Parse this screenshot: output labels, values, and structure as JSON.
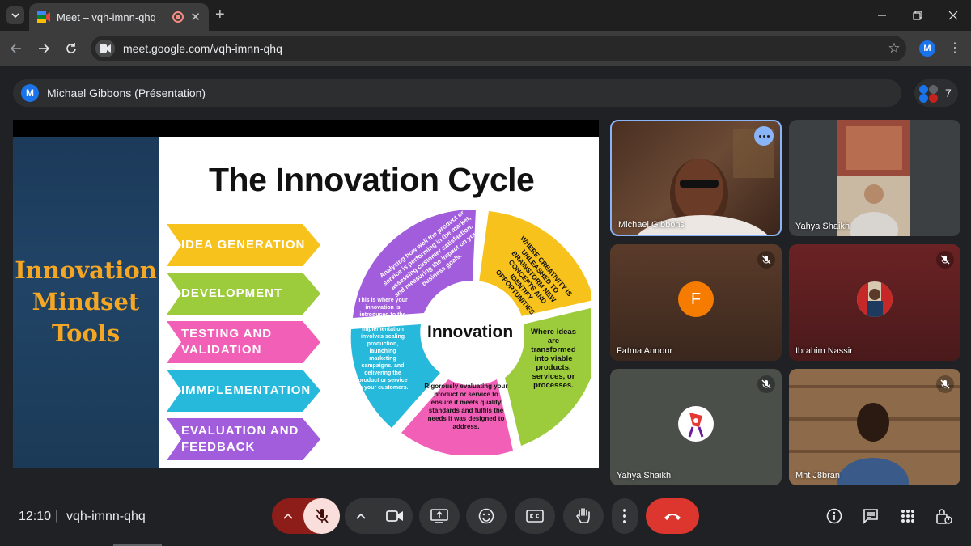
{
  "browser": {
    "tab_title": "Meet – vqh-imnn-qhq",
    "url": "meet.google.com/vqh-imnn-qhq",
    "profile_initial": "M"
  },
  "meet": {
    "presenter_initial": "M",
    "presenter_label": "Michael Gibbons (Présentation)",
    "participant_count": "7",
    "clock": "12:10",
    "separator": "|",
    "meeting_code": "vqh-imnn-qhq"
  },
  "slide": {
    "left_title_lines": [
      "Innovation",
      "Mindset",
      "Tools"
    ],
    "title": "The Innovation Cycle",
    "stages": [
      {
        "lines": [
          "IDEA GENERATION"
        ],
        "color": "#f7c21b"
      },
      {
        "lines": [
          "DEVELOPMENT"
        ],
        "color": "#9ccb3b"
      },
      {
        "lines": [
          "TESTING AND",
          "VALIDATION"
        ],
        "color": "#f25fb6"
      },
      {
        "lines": [
          "IMMPLEMENTATION"
        ],
        "color": "#26b9db"
      },
      {
        "lines": [
          "EVALUATION AND",
          "FEEDBACK"
        ],
        "color": "#a25ddc"
      }
    ],
    "cycle": {
      "center": "Innovation",
      "seg_purple": "Analyzing how well the product or service is performing in the market, assessing customer satisfaction, and measuring the impact on your business goals.",
      "seg_yellow": "WHERE CREATIVITY IS UNLEASHED TO BRAINSTORM NEW CONCEPTS AND IDENTIFY OPPORTUNITIES",
      "seg_green": "Where ideas are transformed into viable products, services, or processes.",
      "seg_pink": "Rigorously evaluating your product or service to ensure it meets quality standards and fulfils the needs it was designed to address.",
      "seg_cyan": "This is where your innovation is introduced to the market. Implementation involves scaling production, launching marketing campaigns, and delivering the product or service to your customers."
    }
  },
  "tiles": [
    {
      "name": "Michael Gibbons",
      "muted": false,
      "kind": "video"
    },
    {
      "name": "Yahya Shaikh",
      "muted": false,
      "kind": "video"
    },
    {
      "name": "Fatma Annour",
      "muted": true,
      "kind": "avatar",
      "initial": "F"
    },
    {
      "name": "Ibrahim Nassir",
      "muted": true,
      "kind": "photo"
    },
    {
      "name": "Yahya Shaikh",
      "muted": true,
      "kind": "sticker"
    },
    {
      "name": "Mht J8bran",
      "muted": true,
      "kind": "video"
    }
  ],
  "colors": {
    "accent_blue": "#8ab4f8",
    "end_call_red": "#dc362e",
    "mic_off_bg": "#f9dedc",
    "fatma_avatar": "#f57c00"
  }
}
